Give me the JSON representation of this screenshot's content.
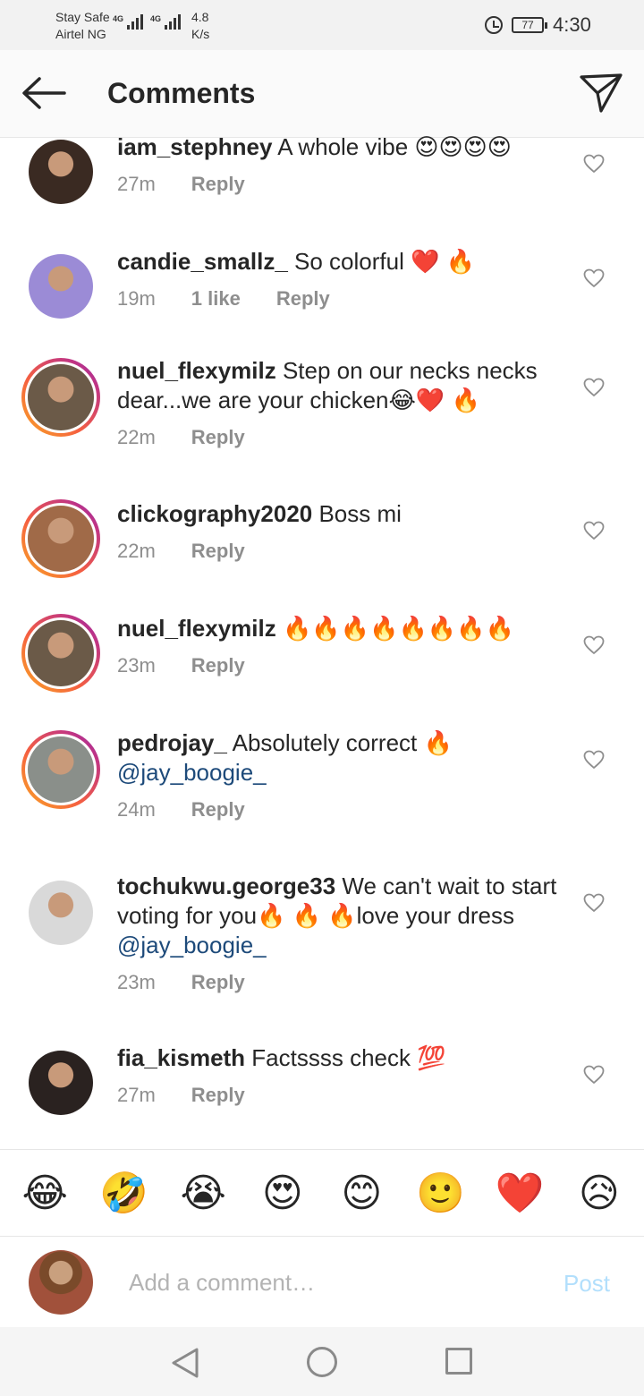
{
  "status_bar": {
    "carrier_line1": "Stay Safe",
    "carrier_line2": "Airtel NG",
    "network1": "4G",
    "network2": "4G",
    "speed_value": "4.8",
    "speed_unit": "K/s",
    "battery": "77",
    "time": "4:30"
  },
  "header": {
    "title": "Comments",
    "back_icon": "arrow-left-icon",
    "send_icon": "paper-plane-icon"
  },
  "comments": [
    {
      "username": "iam_stephney",
      "text": " A whole vibe 😍😍😍😍",
      "time": "27m",
      "likes": "",
      "reply": "Reply",
      "avatar_color": "#3a2a22",
      "ring": false
    },
    {
      "username": "candie_smallz_",
      "text": " So colorful ❤️ 🔥",
      "time": "19m",
      "likes": "1 like",
      "reply": "Reply",
      "avatar_color": "#9b8bd6",
      "ring": false
    },
    {
      "username": "nuel_flexymilz",
      "text": " Step on our necks necks dear...we are your chicken😂❤️ 🔥",
      "time": "22m",
      "likes": "",
      "reply": "Reply",
      "avatar_color": "#6b5a48",
      "ring": true
    },
    {
      "username": "clickography2020",
      "text": " Boss mi",
      "time": "22m",
      "likes": "",
      "reply": "Reply",
      "avatar_color": "#a06a48",
      "ring": true
    },
    {
      "username": "nuel_flexymilz",
      "text": " 🔥🔥🔥🔥🔥🔥🔥🔥",
      "time": "23m",
      "likes": "",
      "reply": "Reply",
      "avatar_color": "#6b5a48",
      "ring": true
    },
    {
      "username": "pedrojay_",
      "text": " Absolutely correct 🔥 ",
      "mention": "@jay_boogie_",
      "time": "24m",
      "likes": "",
      "reply": "Reply",
      "avatar_color": "#8a8f8a",
      "ring": true
    },
    {
      "username": "tochukwu.george33",
      "text": " We can't wait to start voting for you🔥 🔥 🔥love your dress ",
      "mention": "@jay_boogie_",
      "time": "23m",
      "likes": "",
      "reply": "Reply",
      "avatar_color": "#d9d9d9",
      "ring": false
    },
    {
      "username": "fia_kismeth",
      "text": " Factssss check 💯",
      "time": "27m",
      "likes": "",
      "reply": "Reply",
      "avatar_color": "#2a2220",
      "ring": false
    }
  ],
  "emoji_bar": [
    "😂",
    "🤣",
    "😭",
    "😍",
    "😊",
    "🙂",
    "❤️",
    "😥"
  ],
  "input": {
    "placeholder": "Add a comment…",
    "post_label": "Post"
  },
  "nav": {
    "back": "nav-back-icon",
    "home": "nav-home-icon",
    "recents": "nav-recents-icon"
  }
}
